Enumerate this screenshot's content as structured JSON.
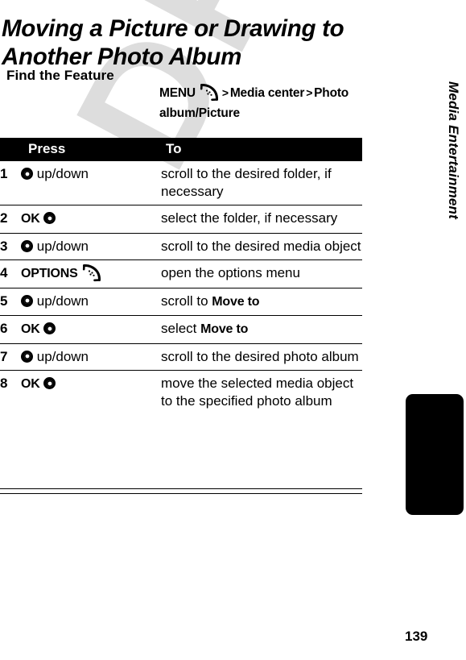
{
  "page": {
    "title": "Moving a Picture or Drawing to Another Photo Album",
    "number": "139",
    "chapter": "Media Entertainment",
    "watermark": "DRAFT"
  },
  "find_the_feature": {
    "label": "Find the Feature",
    "menu_label": "MENU",
    "menu_icon": "softkey-menu-icon",
    "separator_1": ">",
    "crumb_1": "Media center",
    "separator_2": ">",
    "crumb_2": "Photo album/Picture"
  },
  "table": {
    "headers": {
      "num": "",
      "press": "Press",
      "to": "To"
    },
    "rows": [
      {
        "num": "1",
        "press_label": "",
        "press_icon": "nav-key-icon",
        "press_text": "up/down",
        "to": "scroll to the desired folder, if necessary"
      },
      {
        "num": "2",
        "press_label": "OK",
        "press_icon": "nav-key-icon",
        "press_text": "",
        "to": "select the folder, if necessary"
      },
      {
        "num": "3",
        "press_label": "",
        "press_icon": "nav-key-icon",
        "press_text": "up/down",
        "to": "scroll to the desired media object"
      },
      {
        "num": "4",
        "press_label": "OPTIONS",
        "press_icon": "softkey-menu-icon",
        "press_text": "",
        "to": "open the options menu"
      },
      {
        "num": "5",
        "press_label": "",
        "press_icon": "nav-key-icon",
        "press_text": "up/down",
        "to_prefix": "scroll to ",
        "to_emph": "Move to",
        "to": "scroll to Move to"
      },
      {
        "num": "6",
        "press_label": "OK",
        "press_icon": "nav-key-icon",
        "press_text": "",
        "to_prefix": "select ",
        "to_emph": "Move to",
        "to": "select Move to"
      },
      {
        "num": "7",
        "press_label": "",
        "press_icon": "nav-key-icon",
        "press_text": "up/down",
        "to": "scroll to the desired photo album"
      },
      {
        "num": "8",
        "press_label": "OK",
        "press_icon": "nav-key-icon",
        "press_text": "",
        "to": "move the selected media object to the specified photo album"
      }
    ]
  },
  "colors": {
    "ink": "#000000",
    "paper": "#ffffff",
    "watermark": "#dddddd"
  }
}
